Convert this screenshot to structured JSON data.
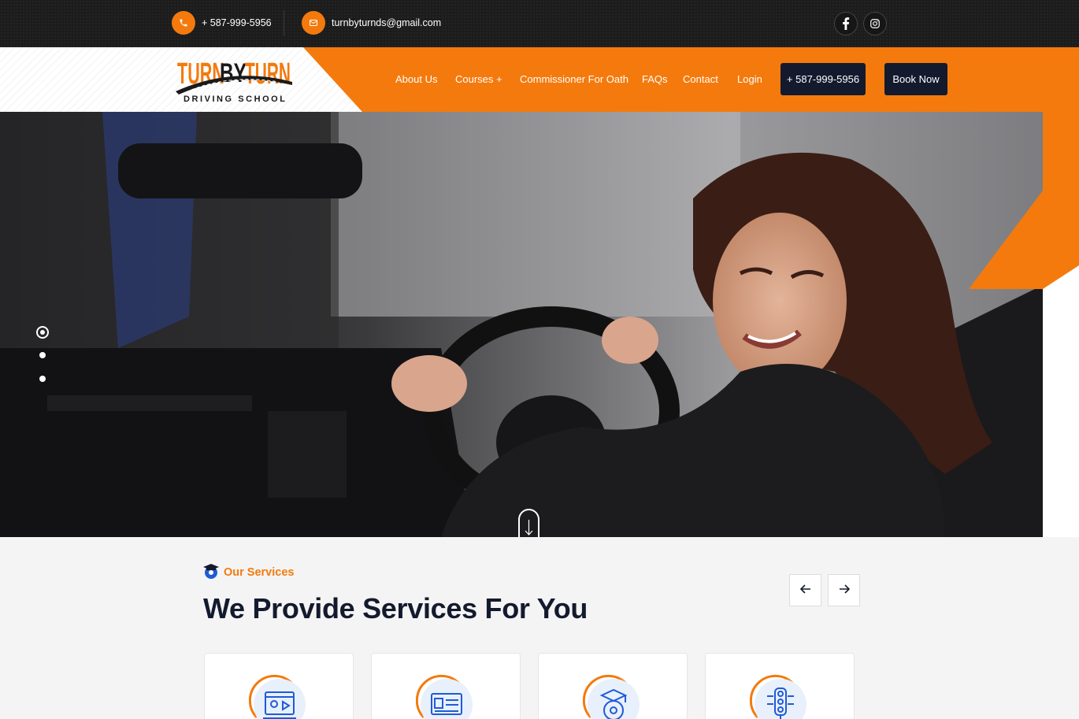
{
  "topbar": {
    "phone": "+ 587-999-5956",
    "email": "turnbyturnds@gmail.com",
    "social": [
      "facebook-icon",
      "instagram-icon"
    ]
  },
  "logo": {
    "line1": "TURN BY TURN",
    "line2": "DRIVING SCHOOL"
  },
  "nav": {
    "items": [
      "About Us",
      "Courses +",
      "Commissioner For Oath",
      "FAQs",
      "Contact",
      "Login"
    ],
    "phone_button": "+ 587-999-5956",
    "book_button": "Book Now"
  },
  "hero": {
    "slides": 3,
    "active_slide": 1
  },
  "services": {
    "tag": "Our Services",
    "title": "We Provide Services For You",
    "cards": [
      "video-lesson-icon",
      "license-card-icon",
      "graduate-wheel-icon",
      "traffic-light-icon"
    ]
  },
  "colors": {
    "accent": "#f47a0d",
    "dark": "#141a2e",
    "topbar": "#1c1c1c"
  }
}
